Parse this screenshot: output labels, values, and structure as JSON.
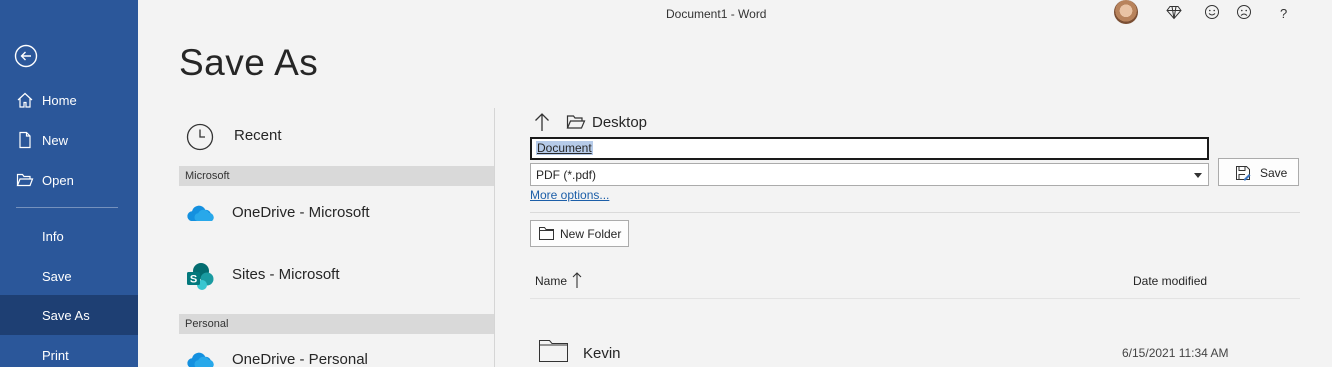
{
  "window": {
    "title": "Document1  -  Word"
  },
  "titlebar": {
    "help_label": "?"
  },
  "sidebar": {
    "items": [
      {
        "label": "Home"
      },
      {
        "label": "New"
      },
      {
        "label": "Open"
      },
      {
        "label": "Info"
      },
      {
        "label": "Save"
      },
      {
        "label": "Save As"
      },
      {
        "label": "Print"
      }
    ]
  },
  "page": {
    "title": "Save As"
  },
  "locations": {
    "recent": "Recent",
    "sections": [
      {
        "header": "Microsoft",
        "items": [
          "OneDrive - Microsoft",
          "Sites - Microsoft"
        ]
      },
      {
        "header": "Personal",
        "items": [
          "OneDrive - Personal"
        ]
      }
    ]
  },
  "browser": {
    "path": "Desktop",
    "filename": "Document",
    "filetype": "PDF (*.pdf)",
    "save_label": "Save",
    "more_options": "More options...",
    "new_folder": "New Folder",
    "columns": {
      "name": "Name",
      "date": "Date modified"
    },
    "files": [
      {
        "name": "Kevin",
        "date": "6/15/2021 11:34 AM",
        "icon": "folder-icon"
      }
    ]
  },
  "colors": {
    "accent": "#2b579a",
    "accent_active": "#1e3f73",
    "link": "#1c5ea8"
  }
}
